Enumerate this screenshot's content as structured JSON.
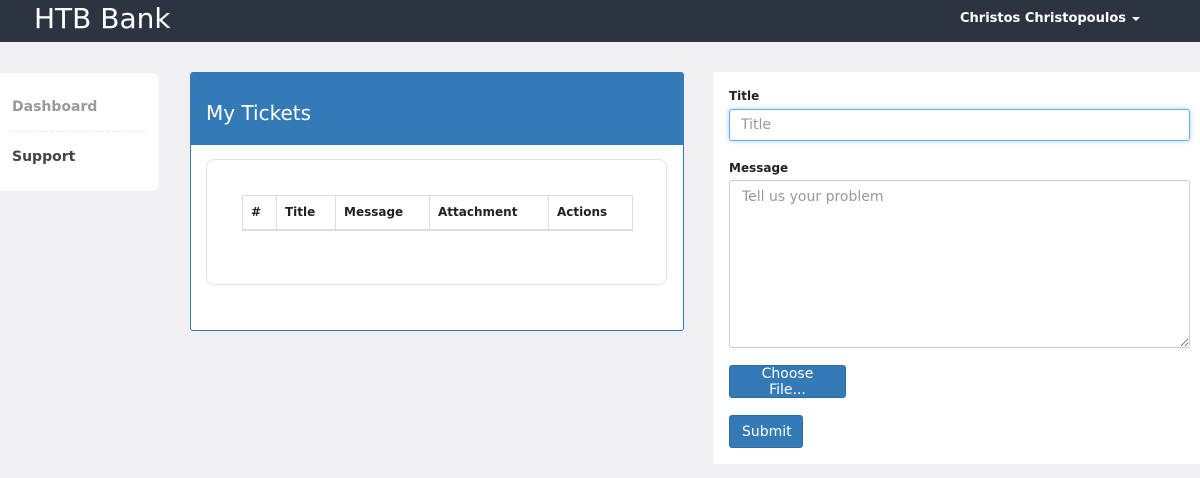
{
  "header": {
    "brand": "HTB Bank",
    "user_name": "Christos Christopoulos"
  },
  "sidebar": {
    "items": [
      {
        "label": "Dashboard"
      },
      {
        "label": "Support"
      }
    ]
  },
  "tickets": {
    "title": "My Tickets",
    "columns": [
      "#",
      "Title",
      "Message",
      "Attachment",
      "Actions"
    ],
    "rows": []
  },
  "form": {
    "title_label": "Title",
    "title_placeholder": "Title",
    "title_value": "",
    "message_label": "Message",
    "message_placeholder": "Tell us your problem",
    "message_value": "",
    "file_button": "Choose File...",
    "submit_button": "Submit"
  },
  "colors": {
    "navbar": "#2b3440",
    "primary": "#337ab7",
    "background": "#f0f0f4"
  }
}
